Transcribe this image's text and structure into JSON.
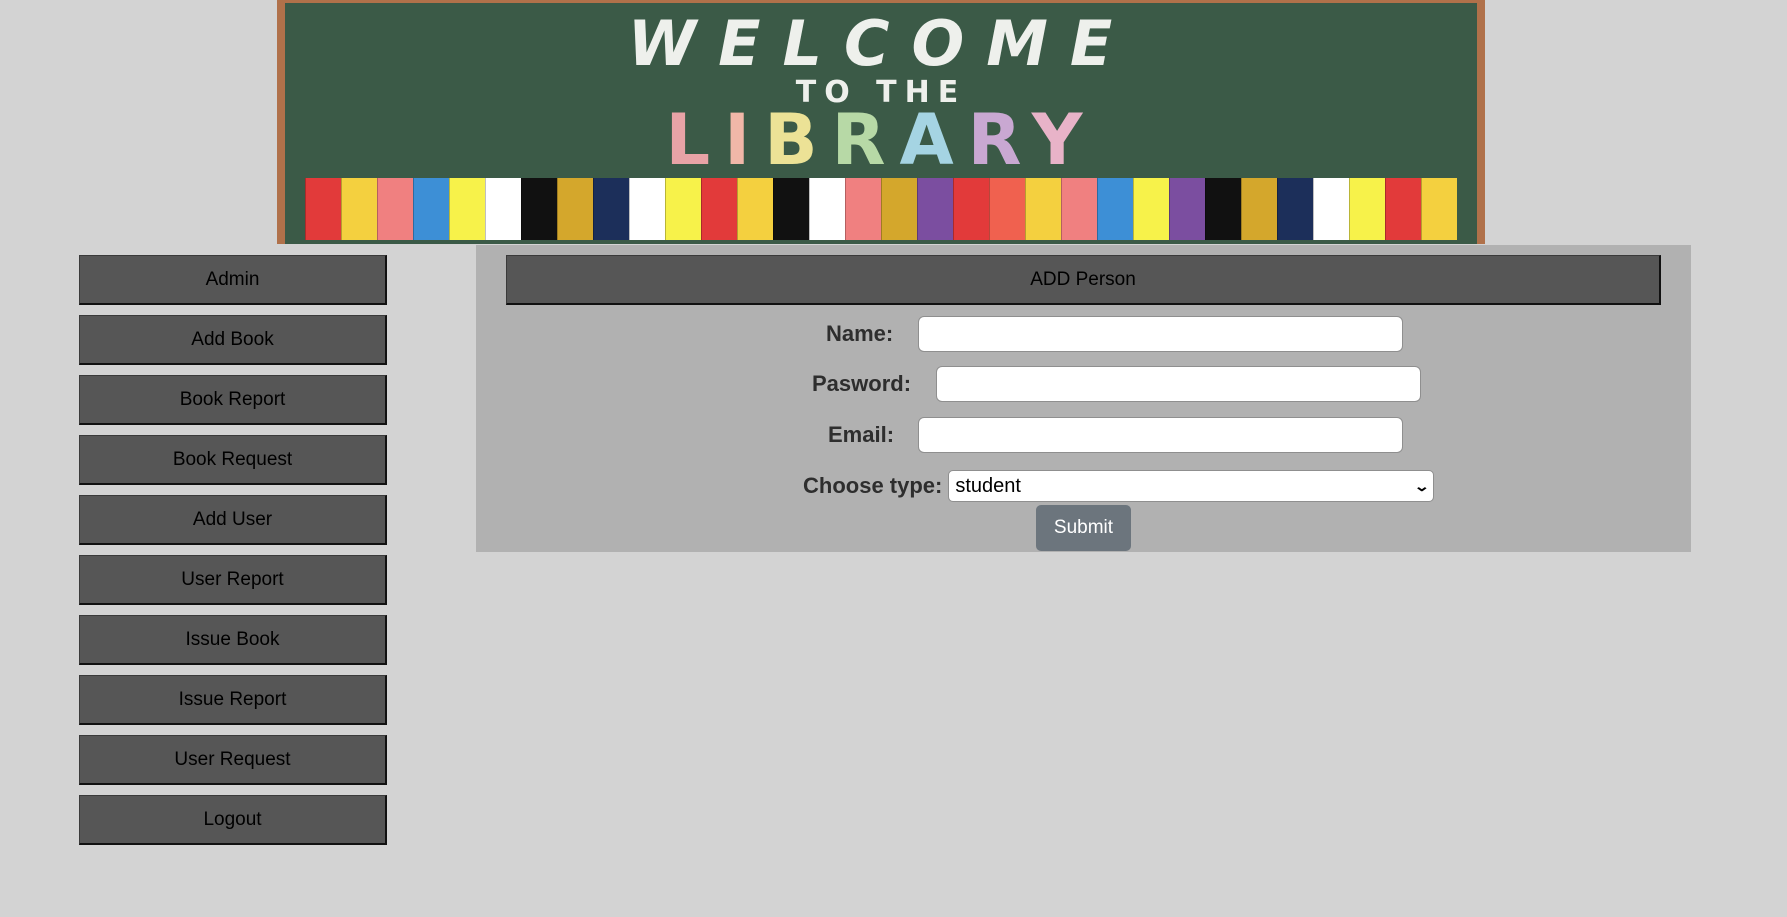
{
  "banner": {
    "line1": "WELCOME",
    "line2": "TO THE",
    "line3": [
      "L",
      "I",
      "B",
      "R",
      "A",
      "R",
      "Y"
    ]
  },
  "sidebar": {
    "items": [
      {
        "label": "Admin"
      },
      {
        "label": "Add Book"
      },
      {
        "label": "Book Report"
      },
      {
        "label": "Book Request"
      },
      {
        "label": "Add User"
      },
      {
        "label": "User Report"
      },
      {
        "label": "Issue Book"
      },
      {
        "label": "Issue Report"
      },
      {
        "label": "User Request"
      },
      {
        "label": "Logout"
      }
    ]
  },
  "form": {
    "title": "ADD Person",
    "name_label": "Name:",
    "name_value": "",
    "password_label": "Pasword:",
    "password_value": "",
    "email_label": "Email:",
    "email_value": "",
    "type_label": "Choose type:",
    "type_selected": "student",
    "submit_label": "Submit"
  },
  "colors": {
    "page_bg": "#d3d3d3",
    "nav_button_bg": "#565656",
    "panel_bg": "#b1b1b1",
    "submit_bg": "#6c757d"
  }
}
